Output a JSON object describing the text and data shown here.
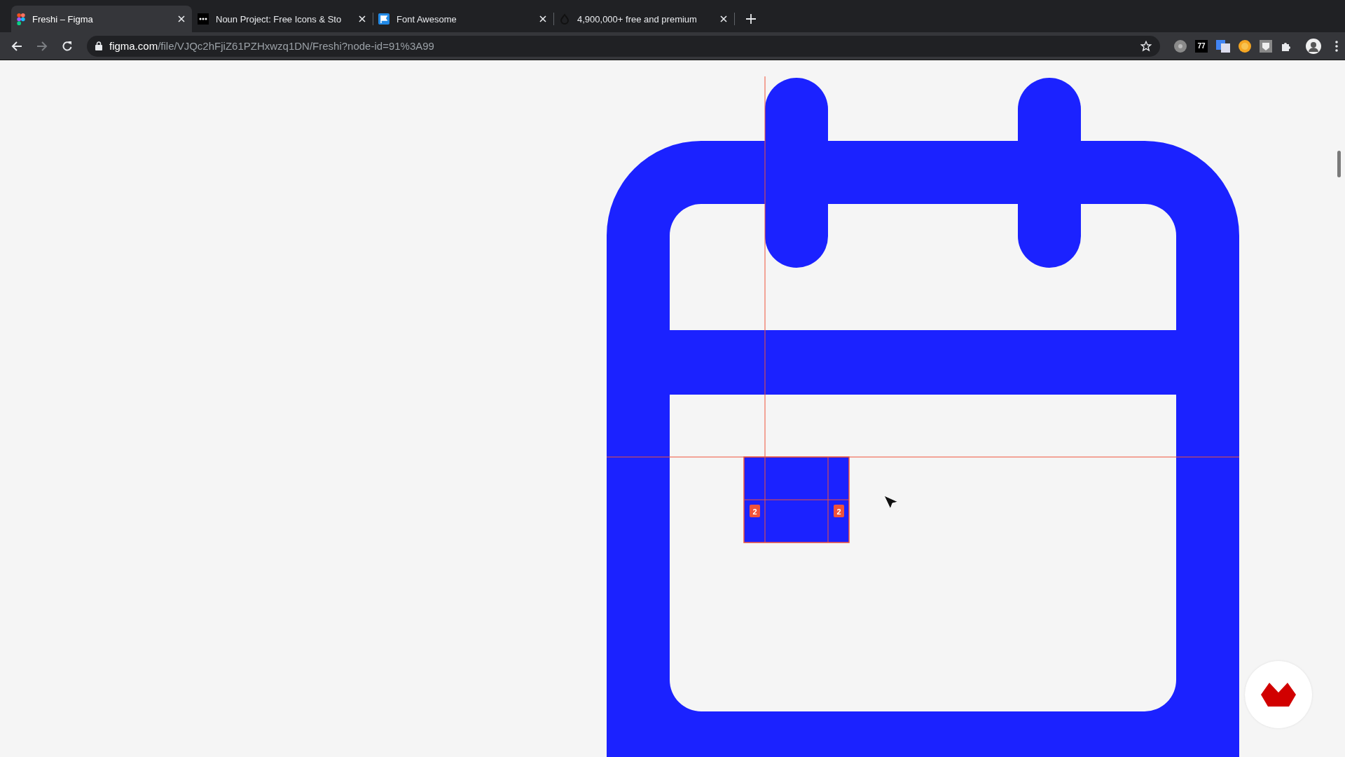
{
  "tabs": [
    {
      "title": "Freshi – Figma",
      "selected": true,
      "kind": "figma"
    },
    {
      "title": "Noun Project: Free Icons & Sto",
      "selected": false,
      "kind": "dots"
    },
    {
      "title": "Font Awesome",
      "selected": false,
      "kind": "flag"
    },
    {
      "title": "4,900,000+ free and premium",
      "selected": false,
      "kind": "drop"
    }
  ],
  "address": {
    "host": "figma.com",
    "path": "/file/VJQc2hFjiZ61PZHxwzq1DN/Freshi?node-id=91%3A99"
  },
  "extensions": [
    {
      "kind": "circle"
    },
    {
      "kind": "text",
      "label": "77"
    },
    {
      "kind": "translate"
    },
    {
      "kind": "coin"
    },
    {
      "kind": "mask"
    },
    {
      "kind": "puzzle"
    }
  ],
  "canvas": {
    "badges": [
      "2",
      "2"
    ]
  }
}
